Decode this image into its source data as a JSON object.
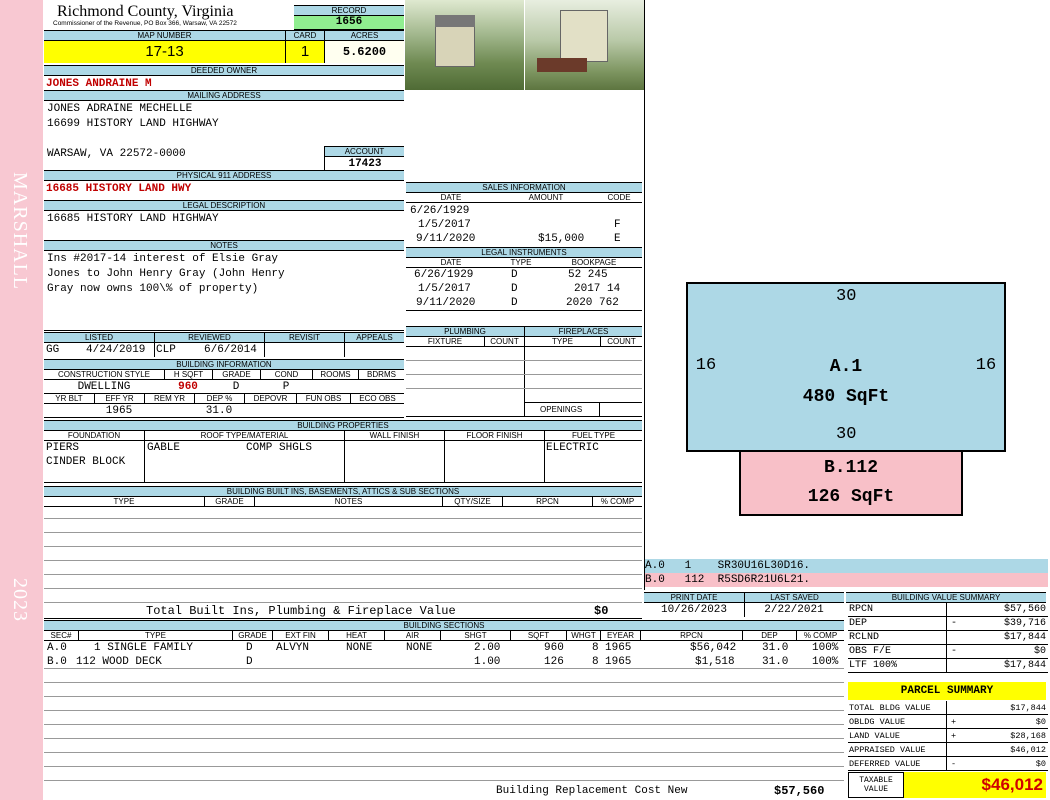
{
  "sidebar": {
    "name": "MARSHALL",
    "year": "2023"
  },
  "header": {
    "county": "Richmond County, Virginia",
    "commissioner": "Commissioner of the Revenue, PO Box 366, Warsaw, VA 22572",
    "record_label": "RECORD",
    "record": "1656",
    "map_label": "MAP NUMBER",
    "map": "17-13",
    "card_label": "CARD",
    "card": "1",
    "acres_label": "ACRES",
    "acres": "5.6200"
  },
  "owner": {
    "label": "DEEDED OWNER",
    "name": "JONES ANDRAINE M"
  },
  "mailing": {
    "label": "MAILING ADDRESS",
    "line1": "JONES ADRAINE MECHELLE",
    "line2": "16699 HISTORY LAND HIGHWAY",
    "line3": "WARSAW, VA 22572-0000",
    "account_label": "ACCOUNT",
    "account": "17423"
  },
  "physical": {
    "label": "PHYSICAL 911 ADDRESS",
    "value": "16685 HISTORY LAND HWY"
  },
  "legal": {
    "label": "LEGAL DESCRIPTION",
    "value": "16685 HISTORY LAND HIGHWAY"
  },
  "notes": {
    "label": "NOTES",
    "line1": "Ins #2017-14 interest of Elsie Gray",
    "line2": "Jones to John Henry Gray (John Henry",
    "line3": "Gray now owns 100\\% of property)"
  },
  "sales": {
    "label": "SALES INFORMATION",
    "headers": [
      "DATE",
      "AMOUNT",
      "CODE"
    ],
    "rows": [
      [
        "6/26/1929",
        "",
        ""
      ],
      [
        "1/5/2017",
        "",
        "F"
      ],
      [
        "9/11/2020",
        "$15,000",
        "E"
      ]
    ]
  },
  "instruments": {
    "label": "LEGAL INSTRUMENTS",
    "headers": [
      "DATE",
      "TYPE",
      "BOOKPAGE"
    ],
    "rows": [
      [
        "6/26/1929",
        "D",
        "52 245"
      ],
      [
        "1/5/2017",
        "D",
        "2017 14"
      ],
      [
        "9/11/2020",
        "D",
        "2020 762"
      ]
    ]
  },
  "listed": {
    "headers": [
      "LISTED",
      "REVIEWED",
      "REVISIT",
      "APPEALS"
    ],
    "listed_by": "GG",
    "listed_date": "4/24/2019",
    "reviewed_by": "CLP",
    "reviewed_date": "6/6/2014"
  },
  "building_info": {
    "label": "BUILDING INFORMATION",
    "headers1": [
      "CONSTRUCTION STYLE",
      "H SQFT",
      "GRADE",
      "COND",
      "ROOMS",
      "BDRMS"
    ],
    "style": "DWELLING",
    "hsqft": "960",
    "grade": "D",
    "cond": "P",
    "headers2": [
      "YR BLT",
      "EFF YR",
      "REM YR",
      "DEP %",
      "DEPOVR",
      "FUN OBS",
      "ECO OBS"
    ],
    "eff_yr": "1965",
    "dep": "31.0"
  },
  "plumbing": {
    "label": "PLUMBING",
    "headers": [
      "FIXTURE",
      "COUNT"
    ]
  },
  "fireplaces": {
    "label": "FIREPLACES",
    "headers": [
      "TYPE",
      "COUNT"
    ],
    "openings": "OPENINGS"
  },
  "properties": {
    "label": "BUILDING PROPERTIES",
    "headers": [
      "FOUNDATION",
      "ROOF TYPE/MATERIAL",
      "WALL FINISH",
      "FLOOR FINISH",
      "FUEL TYPE"
    ],
    "foundation1": "PIERS",
    "foundation2": "CINDER BLOCK",
    "roof_type": "GABLE",
    "roof_mat": "COMP SHGLS",
    "fuel": "ELECTRIC"
  },
  "builtins": {
    "label": "BUILDING BUILT INS, BASEMENTS, ATTICS & SUB SECTIONS",
    "headers": [
      "TYPE",
      "GRADE",
      "NOTES",
      "QTY/SIZE",
      "RPCN",
      "% COMP"
    ],
    "total_label": "Total Built Ins, Plumbing & Fireplace Value",
    "total": "$0"
  },
  "dates": {
    "print_label": "PRINT DATE",
    "print": "10/26/2023",
    "saved_label": "LAST SAVED",
    "saved": "2/22/2021"
  },
  "sections": {
    "label": "BUILDING SECTIONS",
    "headers": [
      "SEC#",
      "TYPE",
      "GRADE",
      "EXT FIN",
      "HEAT",
      "AIR",
      "SHGT",
      "SQFT",
      "WHGT",
      "EYEAR",
      "RPCN",
      "DEP",
      "% COMP"
    ],
    "rows": [
      [
        "A.0",
        "1 SINGLE FAMILY",
        "D",
        "ALVYN",
        "NONE",
        "NONE",
        "2.00",
        "960",
        "8",
        "1965",
        "$56,042",
        "31.0",
        "100%"
      ],
      [
        "B.0",
        "112 WOOD DECK",
        "D",
        "",
        "",
        "",
        "1.00",
        "126",
        "8",
        "1965",
        "$1,518",
        "31.0",
        "100%"
      ]
    ],
    "repl_label": "Building Replacement Cost New",
    "repl": "$57,560"
  },
  "sketch": {
    "a_top": "30",
    "a_left": "16",
    "a_right": "16",
    "a_bottom": "30",
    "a_name": "A.1",
    "a_area": "480 SqFt",
    "b_name": "B.112",
    "b_area": "126 SqFt",
    "a_color": "#add8e6",
    "b_color": "#f8c0c8",
    "leg1": "A.0   1    SR30U16L30D16.",
    "leg2": "B.0   112  R5SD6R21U6L21."
  },
  "value_summary": {
    "label": "BUILDING VALUE SUMMARY",
    "rows": [
      [
        "RPCN",
        "",
        "$57,560"
      ],
      [
        "DEP",
        "-",
        "$39,716"
      ],
      [
        "RCLND",
        "",
        "$17,844"
      ],
      [
        "OBS F/E",
        "-",
        "$0"
      ],
      [
        "LTF   100%",
        "",
        "$17,844"
      ]
    ]
  },
  "parcel": {
    "label": "PARCEL SUMMARY",
    "rows": [
      [
        "TOTAL BLDG VALUE",
        "",
        "$17,844"
      ],
      [
        "OBLDG VALUE",
        "+",
        "$0"
      ],
      [
        "LAND VALUE",
        "+",
        "$28,168"
      ],
      [
        "APPRAISED VALUE",
        "",
        "$46,012"
      ],
      [
        "DEFERRED VALUE",
        "-",
        "$0"
      ]
    ],
    "taxable_label1": "TAXABLE",
    "taxable_label2": "VALUE",
    "taxable": "$46,012",
    "accent": "#ffff00"
  }
}
